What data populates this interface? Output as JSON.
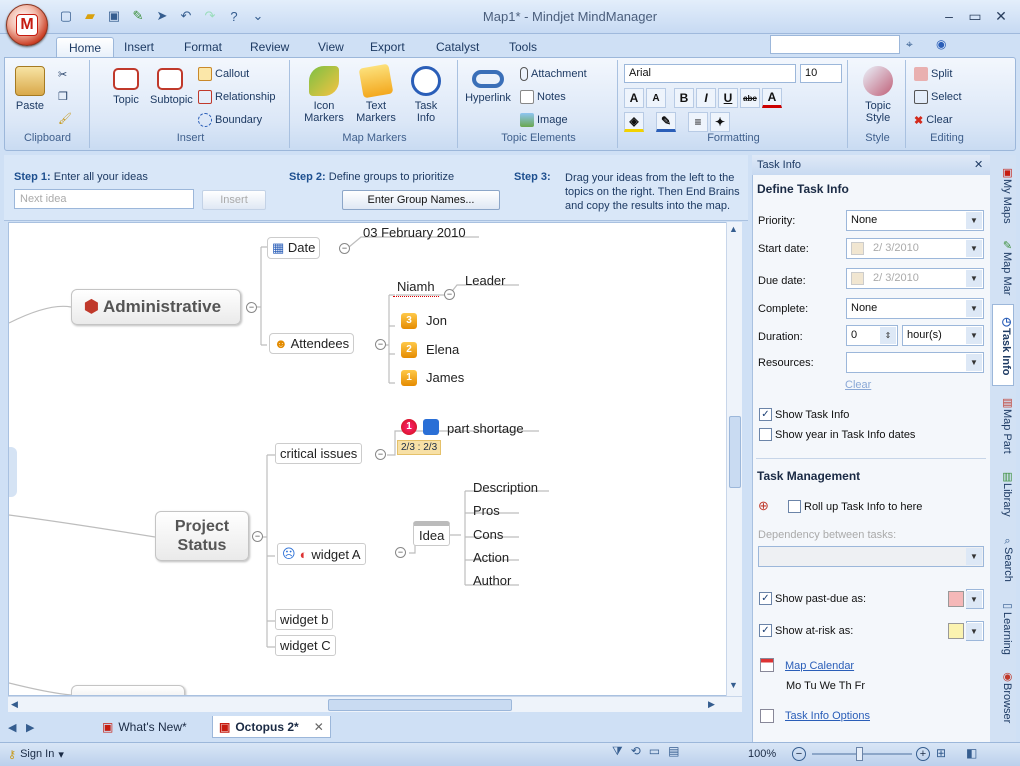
{
  "window": {
    "title": "Map1* - Mindjet MindManager",
    "app_badge": "M"
  },
  "ribbon_tabs": [
    "Home",
    "Insert",
    "Format",
    "Review",
    "View",
    "Export",
    "Catalyst",
    "Tools"
  ],
  "groups": {
    "clipboard": {
      "label": "Clipboard",
      "paste": "Paste"
    },
    "insert": {
      "label": "Insert",
      "topic": "Topic",
      "subtopic": "Subtopic",
      "callout": "Callout",
      "relationship": "Relationship",
      "boundary": "Boundary"
    },
    "markers": {
      "label": "Map Markers",
      "icon_markers": "Icon Markers",
      "text_markers": "Text Markers",
      "task_info": "Task Info"
    },
    "elements": {
      "label": "Topic Elements",
      "hyperlink": "Hyperlink",
      "attachment": "Attachment",
      "notes": "Notes",
      "image": "Image"
    },
    "formatting": {
      "label": "Formatting",
      "font": "Arial",
      "size": "10"
    },
    "style": {
      "label": "Style",
      "topic_style": "Topic Style"
    },
    "editing": {
      "label": "Editing",
      "split": "Split",
      "select": "Select",
      "clear": "Clear"
    }
  },
  "steps": {
    "step1_label": "Step 1:",
    "step1_text": "Enter all your ideas",
    "idea_placeholder": "Next idea",
    "insert_btn": "Insert",
    "step2_label": "Step 2:",
    "step2_text": "Define groups to prioritize",
    "group_btn": "Enter Group Names...",
    "step3_label": "Step 3:",
    "step3_line1": "Drag your ideas from the left to the",
    "step3_line2": "topics on the right. Then End Brains",
    "step3_line3": "and copy the results into the map."
  },
  "map": {
    "administrative": "Administrative",
    "date": "Date",
    "date_value": "03 February 2010",
    "attendees": "Attendees",
    "niamh": "Niamh",
    "leader": "Leader",
    "jon": "Jon",
    "elena": "Elena",
    "james": "James",
    "badge_jon": "3",
    "badge_elena": "2",
    "badge_james": "1",
    "project_status": [
      "Project",
      "Status"
    ],
    "critical_issues": "critical issues",
    "part_shortage": "part shortage",
    "progress": "2/3 : 2/3",
    "priority_badge": "1",
    "widget_a": "widget A",
    "idea": "Idea",
    "description": "Description",
    "pros": "Pros",
    "cons": "Cons",
    "action": "Action",
    "author": "Author",
    "widget_b": "widget b",
    "widget_c": "widget C"
  },
  "doc_tabs": [
    "What's New*",
    "Octopus 2*"
  ],
  "status": {
    "sign_in": "Sign In",
    "zoom": "100%"
  },
  "task_panel": {
    "title": "Task Info",
    "heading": "Define Task Info",
    "priority_label": "Priority:",
    "priority_value": "None",
    "start_label": "Start date:",
    "start_value": "2/ 3/2010",
    "due_label": "Due date:",
    "due_value": "2/ 3/2010",
    "complete_label": "Complete:",
    "complete_value": "None",
    "duration_label": "Duration:",
    "duration_value": "0",
    "duration_unit": "hour(s)",
    "resources_label": "Resources:",
    "clear": "Clear",
    "show_task_info": "Show Task Info",
    "show_year": "Show year in Task Info dates",
    "mgmt_heading": "Task Management",
    "rollup": "Roll up Task Info to here",
    "dependency": "Dependency between tasks:",
    "past_due": "Show past-due as:",
    "at_risk": "Show at-risk as:",
    "map_calendar": "Map Calendar",
    "weekdays": "Mo Tu We Th Fr",
    "task_info_options": "Task Info Options",
    "past_due_color": "#f5b8b8",
    "at_risk_color": "#fbf3b0"
  },
  "side_tabs": [
    "My Maps",
    "Map Mar",
    "Task Info",
    "Map Part",
    "Library",
    "Search",
    "Learning",
    "Browser"
  ]
}
